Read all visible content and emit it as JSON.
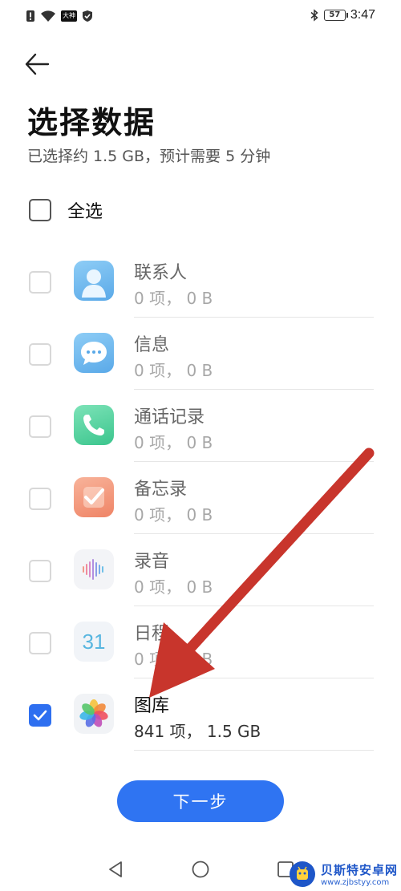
{
  "status_bar": {
    "time": "3:47",
    "battery": "57",
    "app_badge": "大神"
  },
  "header": {
    "title": "选择数据",
    "subtitle": "已选择约 1.5 GB，预计需要 5 分钟"
  },
  "select_all": {
    "label": "全选",
    "checked": false
  },
  "items": [
    {
      "name": "联系人",
      "meta": "0 项， 0 B",
      "icon": "contacts-icon",
      "checked": false
    },
    {
      "name": "信息",
      "meta": "0 项， 0 B",
      "icon": "messages-icon",
      "checked": false
    },
    {
      "name": "通话记录",
      "meta": "0 项， 0 B",
      "icon": "phone-icon",
      "checked": false
    },
    {
      "name": "备忘录",
      "meta": "0 项， 0 B",
      "icon": "notes-icon",
      "checked": false
    },
    {
      "name": "录音",
      "meta": "0 项， 0 B",
      "icon": "recorder-icon",
      "checked": false
    },
    {
      "name": "日程",
      "meta": "0 项， 0 B",
      "icon": "calendar-icon",
      "icon_text": "31",
      "checked": false
    },
    {
      "name": "图库",
      "meta": "841 项， 1.5 GB",
      "icon": "gallery-icon",
      "checked": true
    }
  ],
  "next_button": {
    "label": "下一步"
  },
  "watermark": {
    "title": "贝斯特安卓网",
    "url": "www.zjbstyy.com"
  },
  "colors": {
    "accent": "#2f74f2",
    "annotation_arrow": "#c8352c"
  }
}
